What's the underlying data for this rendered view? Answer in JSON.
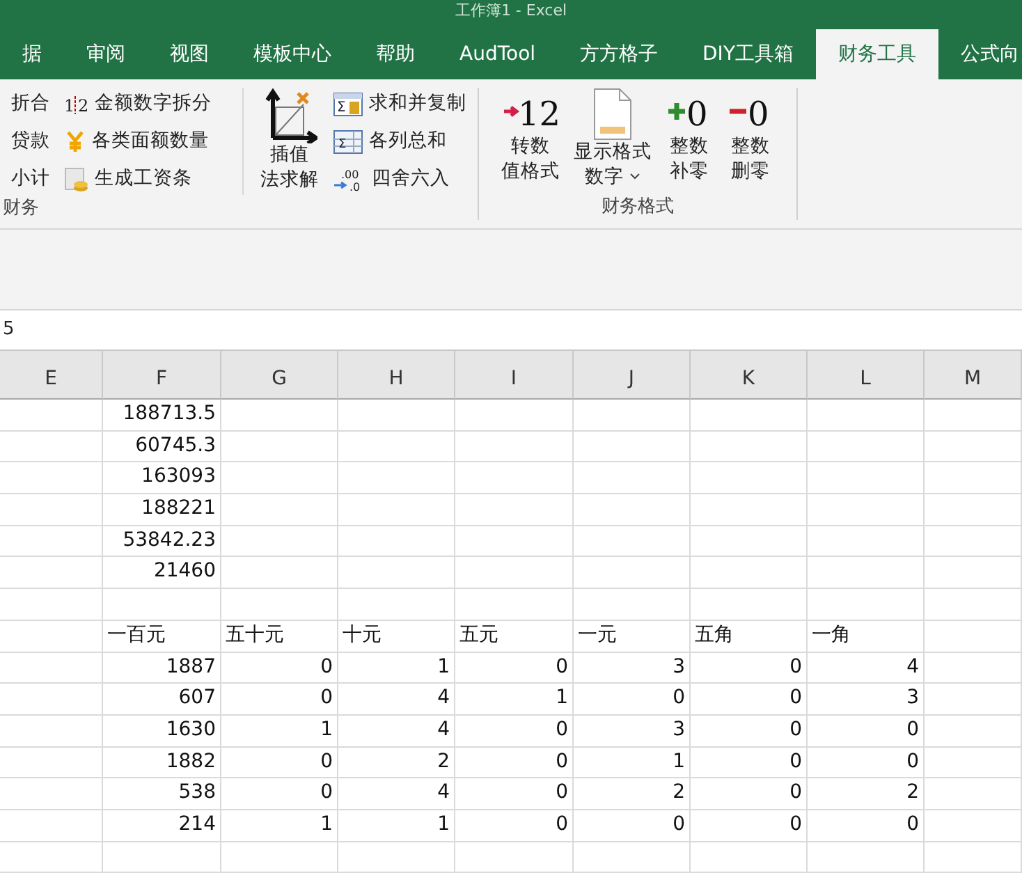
{
  "window": {
    "title": "工作簿1 - Excel"
  },
  "tabs": [
    {
      "label": "据",
      "selected": false
    },
    {
      "label": "审阅",
      "selected": false
    },
    {
      "label": "视图",
      "selected": false
    },
    {
      "label": "模板中心",
      "selected": false
    },
    {
      "label": "帮助",
      "selected": false
    },
    {
      "label": "AudTool",
      "selected": false
    },
    {
      "label": "方方格子",
      "selected": false
    },
    {
      "label": "DIY工具箱",
      "selected": false
    },
    {
      "label": "财务工具",
      "selected": true
    },
    {
      "label": "公式向",
      "selected": false
    }
  ],
  "ribbon": {
    "groups": [
      {
        "label": "财务",
        "columns": [
          [
            {
              "kind": "small-noicon",
              "label": "折合"
            },
            {
              "kind": "small-noicon",
              "label": "贷款"
            },
            {
              "kind": "small-noicon",
              "label": "小计"
            }
          ],
          [
            {
              "kind": "small",
              "label": "金额数字拆分",
              "icon_text": [
                "1",
                "2"
              ]
            },
            {
              "kind": "small",
              "label": "各类面额数量"
            },
            {
              "kind": "small",
              "label": "生成工资条"
            }
          ],
          [
            {
              "kind": "large",
              "label_lines": [
                "插值",
                "法求解"
              ]
            }
          ],
          [
            {
              "kind": "small",
              "label": "求和并复制",
              "icon_text": [
                "Σ"
              ]
            },
            {
              "kind": "small",
              "label": "各列总和",
              "icon_text": [
                "Σ"
              ]
            },
            {
              "kind": "small",
              "label": "四舍六入",
              "icon_text": [
                ".00",
                ".0"
              ]
            }
          ]
        ]
      },
      {
        "label": "财务格式",
        "columns": [
          [
            {
              "kind": "large",
              "label_lines": [
                "转数",
                "值格式"
              ],
              "icon_text": [
                "12"
              ]
            }
          ],
          [
            {
              "kind": "large",
              "label_lines": [
                "显示格式",
                "数字"
              ],
              "dropdown": true
            }
          ],
          [
            {
              "kind": "large",
              "label_lines": [
                "整数",
                "补零"
              ],
              "icon_text": [
                "0"
              ]
            }
          ],
          [
            {
              "kind": "large",
              "label_lines": [
                "整数",
                "删零"
              ],
              "icon_text": [
                "0"
              ]
            }
          ]
        ]
      }
    ]
  },
  "formula_bar": {
    "value": "5"
  },
  "sheet": {
    "columns": [
      "E",
      "F",
      "G",
      "H",
      "I",
      "J",
      "K",
      "L",
      "M"
    ],
    "rows": [
      {
        "kind": "number",
        "cells": {
          "F": "188713.5"
        }
      },
      {
        "kind": "number",
        "cells": {
          "F": "60745.3"
        }
      },
      {
        "kind": "number",
        "cells": {
          "F": "163093"
        }
      },
      {
        "kind": "number",
        "cells": {
          "F": "188221"
        }
      },
      {
        "kind": "number",
        "cells": {
          "F": "53842.23"
        }
      },
      {
        "kind": "number",
        "cells": {
          "F": "21460"
        }
      },
      {
        "kind": "blank"
      },
      {
        "kind": "text",
        "cells": {
          "F": "一百元",
          "G": "五十元",
          "H": "十元",
          "I": "五元",
          "J": "一元",
          "K": "五角",
          "L": "一角"
        }
      },
      {
        "kind": "number",
        "cells": {
          "F": "1887",
          "G": "0",
          "H": "1",
          "I": "0",
          "J": "3",
          "K": "0",
          "L": "4"
        }
      },
      {
        "kind": "number",
        "cells": {
          "F": "607",
          "G": "0",
          "H": "4",
          "I": "1",
          "J": "0",
          "K": "0",
          "L": "3"
        }
      },
      {
        "kind": "number",
        "cells": {
          "F": "1630",
          "G": "1",
          "H": "4",
          "I": "0",
          "J": "3",
          "K": "0",
          "L": "0"
        }
      },
      {
        "kind": "number",
        "cells": {
          "F": "1882",
          "G": "0",
          "H": "2",
          "I": "0",
          "J": "1",
          "K": "0",
          "L": "0"
        }
      },
      {
        "kind": "number",
        "cells": {
          "F": "538",
          "G": "0",
          "H": "4",
          "I": "0",
          "J": "2",
          "K": "0",
          "L": "2"
        }
      },
      {
        "kind": "number",
        "cells": {
          "F": "214",
          "G": "1",
          "H": "1",
          "I": "0",
          "J": "0",
          "K": "0",
          "L": "0"
        }
      },
      {
        "kind": "blank"
      }
    ]
  }
}
